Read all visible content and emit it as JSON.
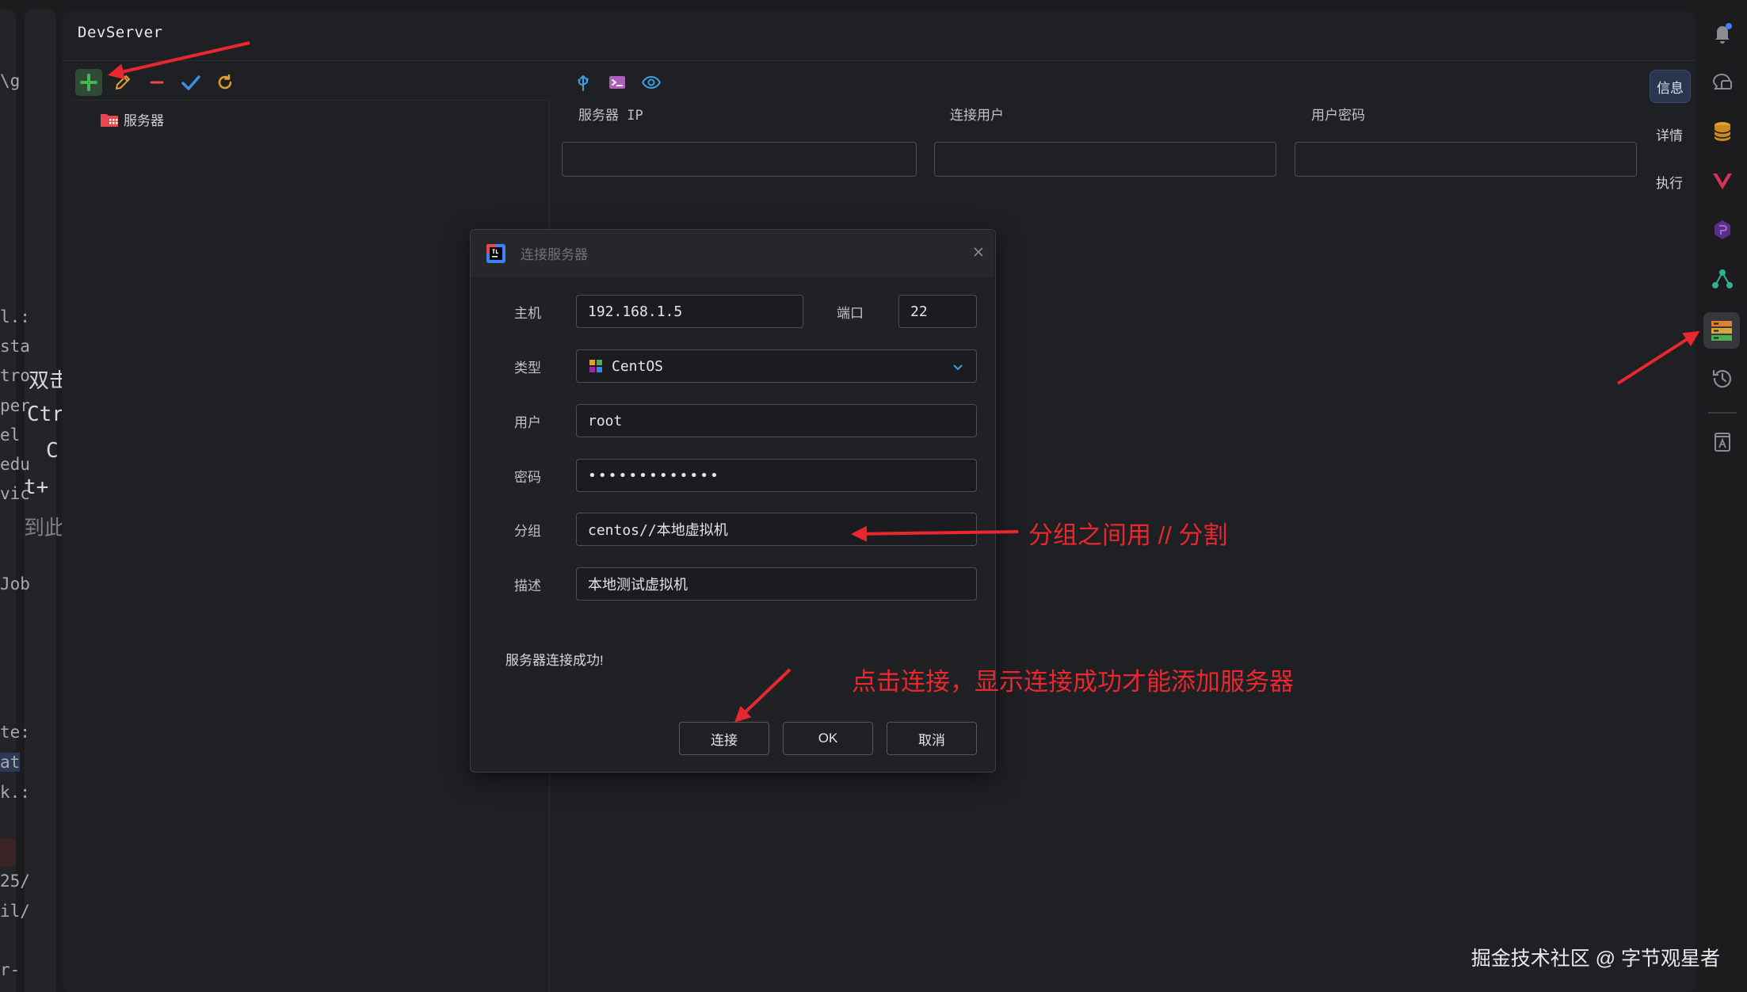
{
  "app": {
    "title": "DevServer"
  },
  "left_fragments": [
    "\\g",
    "l.:",
    "sta",
    "tro",
    "per",
    "el",
    "edu",
    "vic",
    "Job",
    "te:",
    "at",
    "k.:",
    "25/",
    "il/",
    "r-"
  ],
  "left_fragments_large": [
    "双击",
    "Ctrl",
    "C",
    "t+",
    "到此"
  ],
  "toolbar": {
    "add": "plus-icon",
    "edit": "pencil-icon",
    "remove": "minus-icon",
    "confirm": "check-icon",
    "refresh": "refresh-icon"
  },
  "tree": {
    "root_label": "服务器"
  },
  "detail": {
    "tools": [
      "usb-icon",
      "terminal-icon",
      "eye-icon"
    ],
    "columns": [
      "服务器 IP",
      "连接用户",
      "用户密码"
    ]
  },
  "side_tabs": {
    "info": "信息",
    "details": "详情",
    "execute": "执行"
  },
  "dialog": {
    "title": "连接服务器",
    "host_label": "主机",
    "host_value": "192.168.1.5",
    "port_label": "端口",
    "port_value": "22",
    "type_label": "类型",
    "type_value": "CentOS",
    "user_label": "用户",
    "user_value": "root",
    "password_label": "密码",
    "password_value": "•••••••••••••",
    "group_label": "分组",
    "group_value": "centos//本地虚拟机",
    "desc_label": "描述",
    "desc_value": "本地测试虚拟机",
    "status": "服务器连接成功!",
    "buttons": {
      "connect": "连接",
      "ok": "OK",
      "cancel": "取消"
    }
  },
  "annotations": {
    "group_note": "分组之间用 // 分割",
    "connect_note": "点击连接，显示连接成功才能添加服务器"
  },
  "watermark": "掘金技术社区 @ 字节观星者",
  "colors": {
    "accent_red": "#e8282e",
    "add_green": "#3fb950",
    "info_tab": "#2a3650"
  }
}
